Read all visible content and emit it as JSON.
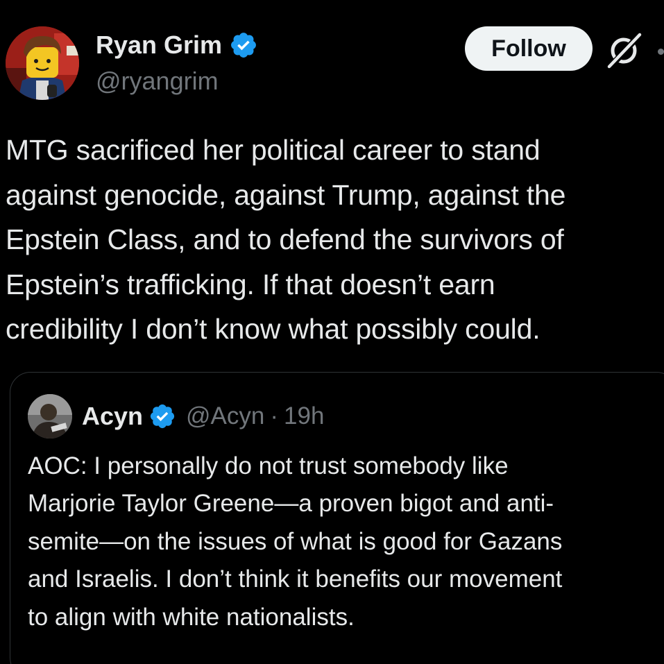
{
  "author": {
    "name": "Ryan Grim",
    "handle": "@ryangrim"
  },
  "follow_label": "Follow",
  "tweet_text": "MTG sacrificed her political career to stand\nagainst genocide, against Trump, against the\nEpstein Class, and to defend the survivors of\nEpstein’s trafficking. If that doesn’t earn\ncredibility I don’t know what possibly could.",
  "quote": {
    "name": "Acyn",
    "handle": "@Acyn",
    "separator": "·",
    "time": "19h",
    "text": "AOC: I personally do not trust somebody like\nMarjorie Taylor Greene—a proven bigot and anti-\nsemite—on the issues of  what is good for Gazans\nand Israelis. I don’t think it benefits our movement\nto align with white nationalists."
  },
  "icons": {
    "verified": "verified-badge-icon",
    "grok": "grok-icon"
  },
  "colors": {
    "background": "#000000",
    "text": "#e7e9ea",
    "secondary": "#71767b",
    "verified": "#1d9bf0",
    "follow_bg": "#eff3f4",
    "border": "#2f3336"
  }
}
